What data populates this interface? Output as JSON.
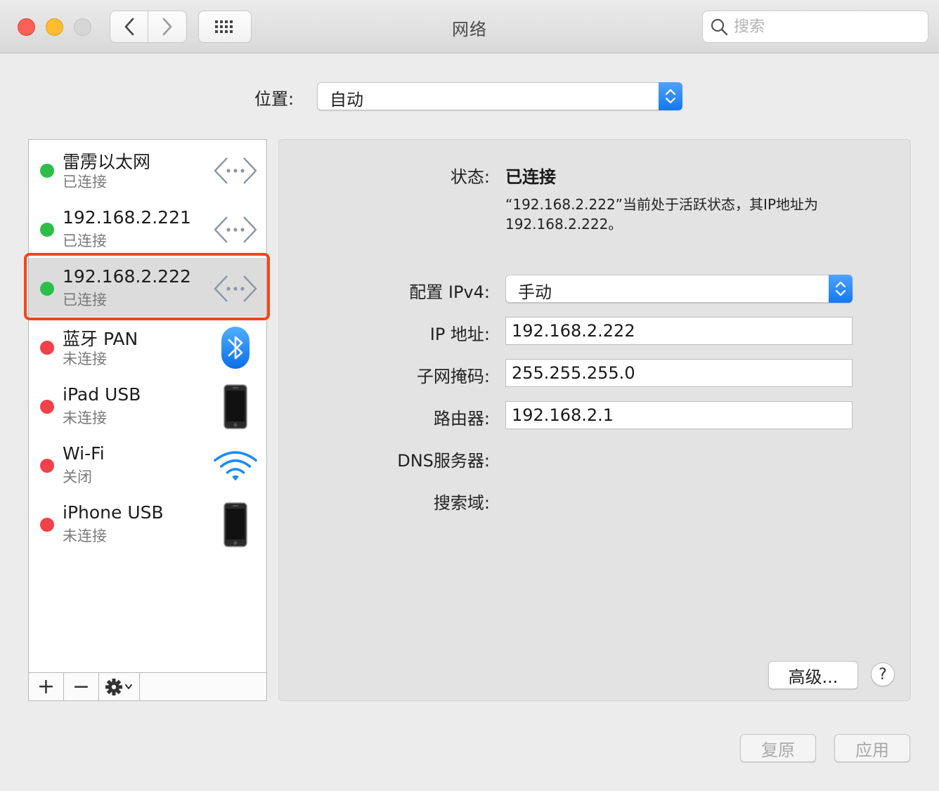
{
  "window": {
    "title": "网络",
    "search_placeholder": "搜索"
  },
  "location": {
    "label": "位置:",
    "value": "自动"
  },
  "services": [
    {
      "name": "雷雳以太网",
      "status": "已连接",
      "connected": true,
      "icon": "ethernet-arrows-icon",
      "dot_color": "#2dbd49"
    },
    {
      "name": "192.168.2.221",
      "status": "已连接",
      "connected": true,
      "icon": "ethernet-arrows-icon",
      "dot_color": "#2dbd49"
    },
    {
      "name": "192.168.2.222",
      "status": "已连接",
      "connected": true,
      "icon": "ethernet-arrows-icon",
      "dot_color": "#2dbd49",
      "selected": true
    },
    {
      "name": "蓝牙 PAN",
      "status": "未连接",
      "connected": false,
      "icon": "bluetooth-icon",
      "dot_color": "#f1414b"
    },
    {
      "name": "iPad USB",
      "status": "未连接",
      "connected": false,
      "icon": "iphone-device-icon",
      "dot_color": "#f1414b"
    },
    {
      "name": "Wi-Fi",
      "status": "关闭",
      "connected": false,
      "icon": "wifi-icon",
      "dot_color": "#f1414b"
    },
    {
      "name": "iPhone USB",
      "status": "未连接",
      "connected": false,
      "icon": "iphone-device-icon",
      "dot_color": "#f1414b"
    }
  ],
  "sidebar_tools": {
    "add": "+",
    "remove": "−"
  },
  "detail": {
    "status_label": "状态:",
    "status_value": "已连接",
    "status_desc": "“192.168.2.222”当前处于活跃状态，其IP地址为192.168.2.222。",
    "ipv4_label": "配置 IPv4:",
    "ipv4_value": "手动",
    "ip_label": "IP 地址:",
    "ip_value": "192.168.2.222",
    "subnet_label": "子网掩码:",
    "subnet_value": "255.255.255.0",
    "router_label": "路由器:",
    "router_value": "192.168.2.1",
    "dns_label": "DNS服务器:",
    "search_domain_label": "搜索域:",
    "advanced_button": "高级...",
    "help_button": "?"
  },
  "footer": {
    "revert_button": "复原",
    "apply_button": "应用"
  },
  "colors": {
    "accent": "#1577f2",
    "connected": "#2dbd49",
    "disconnected": "#f1414b",
    "selection_outline": "#f2461e"
  }
}
